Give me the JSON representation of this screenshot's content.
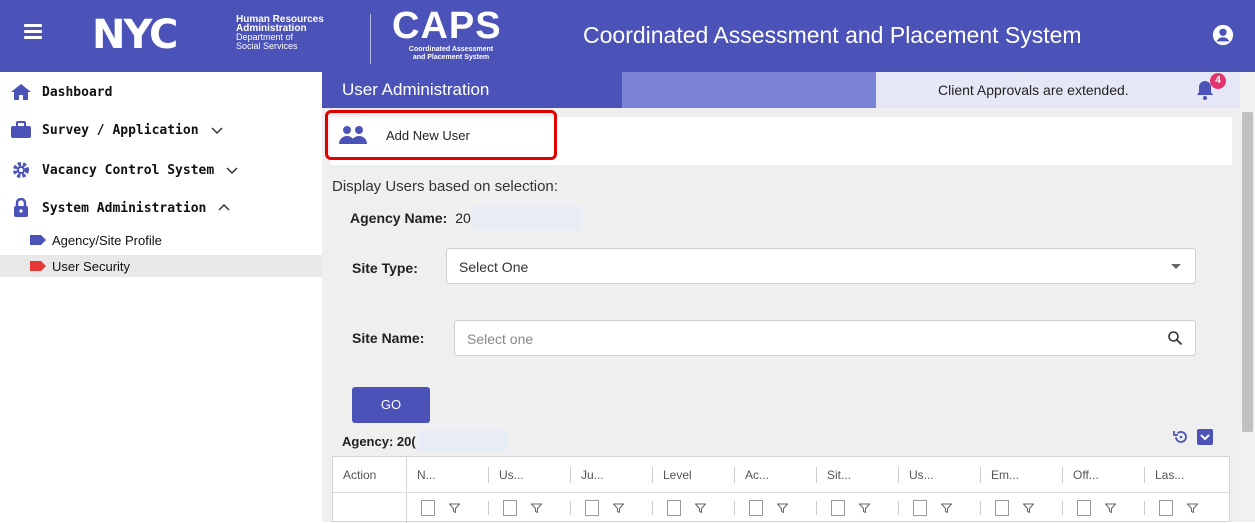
{
  "header": {
    "nyc_logo": "NYC",
    "hra_line1": "Human Resources",
    "hra_line2": "Administration",
    "hra_line3": "Department of",
    "hra_line4": "Social Services",
    "caps_logo": "CAPS",
    "caps_sub1": "Coordinated Assessment",
    "caps_sub2": "and Placement System",
    "app_title": "Coordinated Assessment and Placement System"
  },
  "sidebar": {
    "items": [
      {
        "label": "Dashboard"
      },
      {
        "label": "Survey / Application"
      },
      {
        "label": "Vacancy Control System"
      },
      {
        "label": "System Administration"
      }
    ],
    "sub_items": [
      {
        "label": "Agency/Site Profile"
      },
      {
        "label": "User Security"
      }
    ]
  },
  "page": {
    "title": "User Administration",
    "notice": "Client Approvals are extended.",
    "notification_count": "4",
    "add_user_label": "Add New User",
    "display_label": "Display Users based on selection:",
    "agency_name_label": "Agency Name:",
    "agency_name_value": "20",
    "site_type_label": "Site Type:",
    "site_type_value": "Select One",
    "site_name_label": "Site Name:",
    "site_name_placeholder": "Select one",
    "go_label": "GO",
    "agency_label": "Agency: 20("
  },
  "grid": {
    "columns": [
      "Action",
      "N...",
      "Us...",
      "Ju...",
      "Level",
      "Ac...",
      "Sit...",
      "Us...",
      "Em...",
      "Off...",
      "Las..."
    ]
  },
  "colors": {
    "brand": "#4b52b8",
    "badge": "#e3356d",
    "highlight": "#e00000",
    "active_tag": "#e53935"
  }
}
